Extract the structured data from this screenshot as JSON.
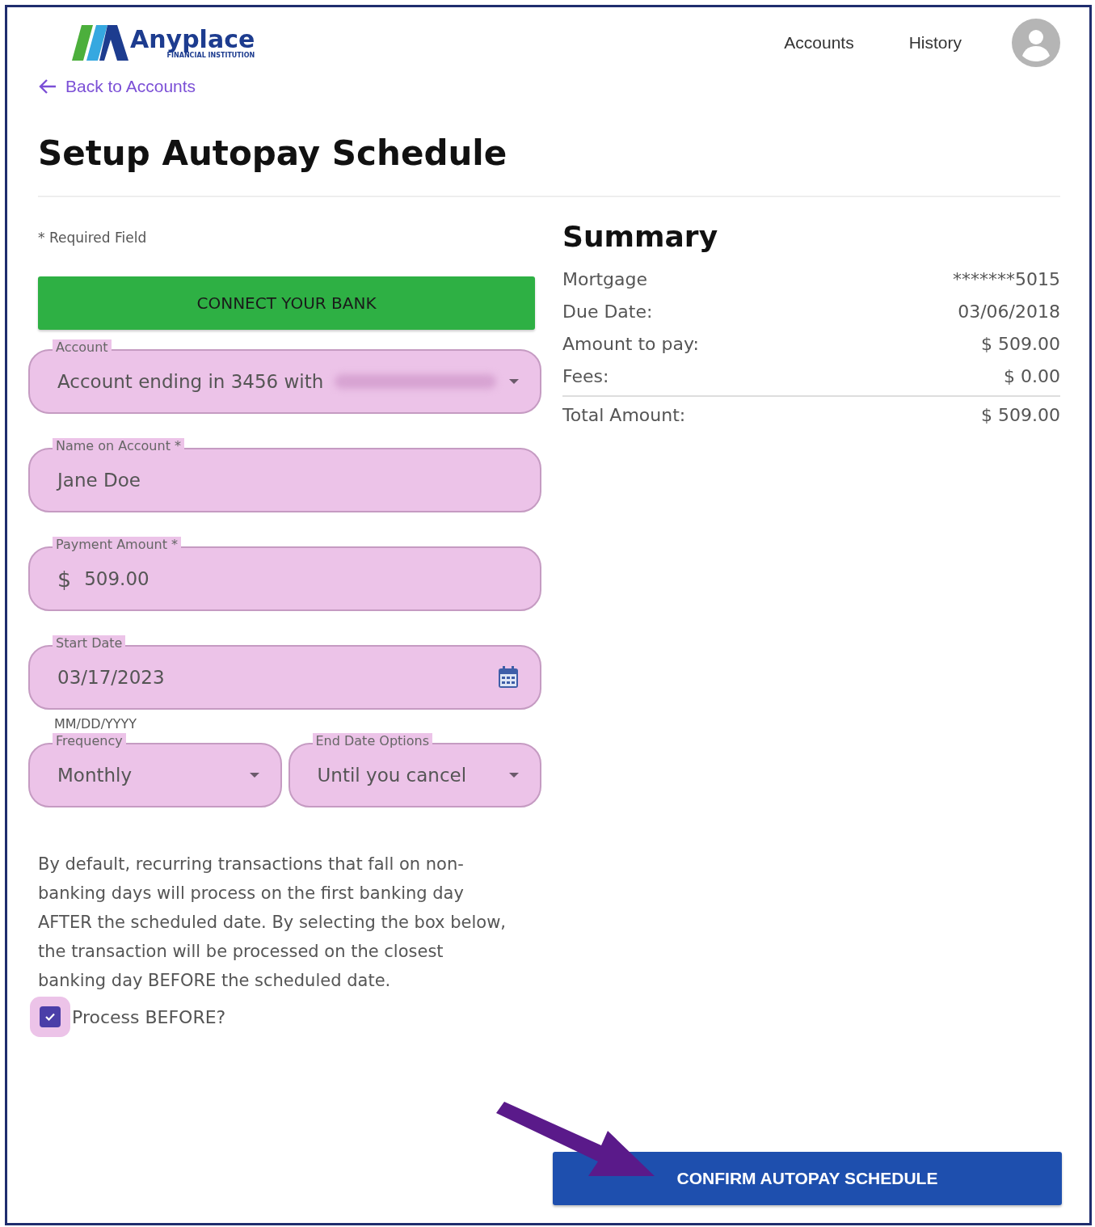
{
  "header": {
    "logo": {
      "name": "Anyplace",
      "tagline": "FINANCIAL INSTITUTION"
    },
    "nav": [
      {
        "label": "Accounts"
      },
      {
        "label": "History"
      }
    ]
  },
  "back_link": "Back to Accounts",
  "title": "Setup Autopay Schedule",
  "form": {
    "required_note": "* Required Field",
    "connect_button": "CONNECT YOUR BANK",
    "fields": [
      {
        "kind": "select",
        "label": "Account",
        "value": "Account ending in 3456 with",
        "redacted": true
      },
      {
        "kind": "text",
        "label": "Name on Account *",
        "value": "Jane Doe"
      },
      {
        "kind": "currency",
        "label": "Payment Amount *",
        "prefix": "$",
        "value": "509.00"
      },
      {
        "kind": "date",
        "label": "Start Date",
        "value": "03/17/2023",
        "helper": "MM/DD/YYYY"
      }
    ],
    "pair": [
      {
        "kind": "select",
        "label": "Frequency",
        "value": "Monthly"
      },
      {
        "kind": "select",
        "label": "End Date Options",
        "value": "Until you cancel"
      }
    ],
    "note": "By default, recurring transactions that fall on non-banking days will process on the first banking day AFTER the scheduled date. By selecting the box below, the transaction will be processed on the closest banking day BEFORE the scheduled date.",
    "checkbox": {
      "label": "Process BEFORE?",
      "checked": true
    }
  },
  "summary": {
    "title": "Summary",
    "rows": [
      {
        "label": "Mortgage",
        "value": "*******5015"
      },
      {
        "label": "Due Date:",
        "value": "03/06/2018"
      },
      {
        "label": "Amount to pay:",
        "value": "$ 509.00"
      },
      {
        "label": "Fees:",
        "value": "$ 0.00"
      }
    ],
    "total": {
      "label": "Total Amount:",
      "value": "$ 509.00"
    }
  },
  "confirm_button": "CONFIRM AUTOPAY SCHEDULE"
}
